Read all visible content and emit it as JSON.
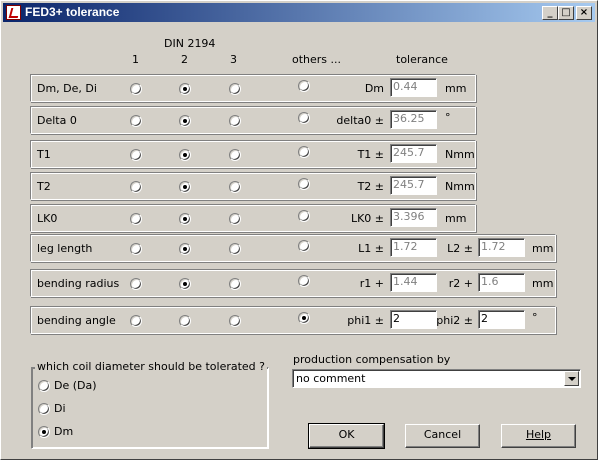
{
  "window": {
    "title": "FED3+ tolerance"
  },
  "titlebar_buttons": {
    "minimize": "_",
    "maximize": "□",
    "close": "×"
  },
  "header": {
    "din": "DIN 2194",
    "col1": "1",
    "col2": "2",
    "col3": "3",
    "others": "others ...",
    "tolerance": "tolerance"
  },
  "rows": [
    {
      "label": "Dm, De, Di",
      "selected": 2,
      "fields": [
        {
          "label": "Dm",
          "value": "0.44",
          "enabled": false
        }
      ],
      "unit": "mm"
    },
    {
      "label": "Delta 0",
      "selected": 2,
      "fields": [
        {
          "label": "delta0 ±",
          "value": "36.25",
          "enabled": false
        }
      ],
      "unit": "°"
    },
    {
      "label": "T1",
      "selected": 2,
      "fields": [
        {
          "label": "T1 ±",
          "value": "245.7",
          "enabled": false
        }
      ],
      "unit": "Nmm"
    },
    {
      "label": "T2",
      "selected": 2,
      "fields": [
        {
          "label": "T2 ±",
          "value": "245.7",
          "enabled": false
        }
      ],
      "unit": "Nmm"
    },
    {
      "label": "LK0",
      "selected": 2,
      "fields": [
        {
          "label": "LK0 ±",
          "value": "3.396",
          "enabled": false
        }
      ],
      "unit": "mm"
    },
    {
      "label": "leg length",
      "selected": 2,
      "fields": [
        {
          "label": "L1 ±",
          "value": "1.72",
          "enabled": false
        },
        {
          "label": "L2 ±",
          "value": "1.72",
          "enabled": false
        }
      ],
      "unit": "mm"
    },
    {
      "label": "bending radius",
      "selected": 2,
      "fields": [
        {
          "label": "r1 +",
          "value": "1.44",
          "enabled": false
        },
        {
          "label": "r2 +",
          "value": "1.6",
          "enabled": false
        }
      ],
      "unit": "mm"
    },
    {
      "label": "bending angle",
      "selected": 4,
      "fields": [
        {
          "label": "phi1 ±",
          "value": "2",
          "enabled": true
        },
        {
          "label": "phi2 ±",
          "value": "2",
          "enabled": true
        }
      ],
      "unit": "°"
    }
  ],
  "coil": {
    "title": "which coil diameter should be tolerated ?",
    "options": [
      "De (Da)",
      "Di",
      "Dm"
    ],
    "selected": 2
  },
  "production": {
    "label": "production compensation by",
    "value": "no comment"
  },
  "buttons": {
    "ok": "OK",
    "cancel": "Cancel",
    "help": "Help"
  }
}
